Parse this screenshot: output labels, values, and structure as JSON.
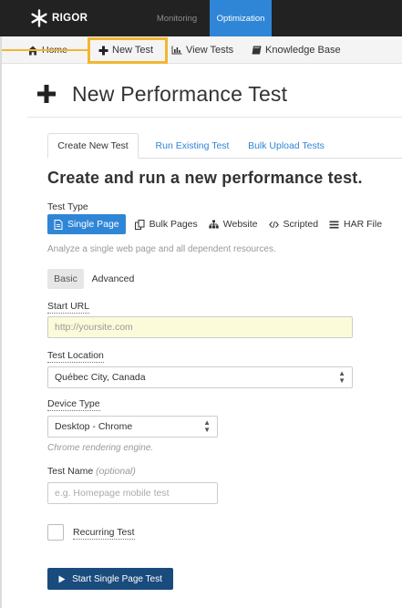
{
  "topbar": {
    "logo_text": "RIGOR",
    "tabs": [
      {
        "label": "Monitoring"
      },
      {
        "label": "Optimization"
      }
    ]
  },
  "subnav": {
    "items": [
      {
        "label": "Home",
        "icon": "home-icon"
      },
      {
        "label": "New Test",
        "icon": "plus-icon"
      },
      {
        "label": "View Tests",
        "icon": "bar-chart-icon"
      },
      {
        "label": "Knowledge Base",
        "icon": "book-icon"
      }
    ]
  },
  "page": {
    "title": "New Performance Test"
  },
  "tabs": [
    {
      "label": "Create New Test"
    },
    {
      "label": "Run Existing Test"
    },
    {
      "label": "Bulk Upload Tests"
    }
  ],
  "form": {
    "heading": "Create and run a new performance test.",
    "test_type_label": "Test Type",
    "test_types": [
      {
        "label": "Single Page",
        "icon": "document-icon"
      },
      {
        "label": "Bulk Pages",
        "icon": "copy-icon"
      },
      {
        "label": "Website",
        "icon": "sitemap-icon"
      },
      {
        "label": "Scripted",
        "icon": "code-icon"
      },
      {
        "label": "HAR File",
        "icon": "list-icon"
      }
    ],
    "test_type_help": "Analyze a single web page and all dependent resources.",
    "modes": {
      "basic": "Basic",
      "advanced": "Advanced"
    },
    "start_url_label": "Start URL",
    "start_url_placeholder": "http://yoursite.com",
    "location_label": "Test Location",
    "location_value": "Québec City, Canada",
    "device_label": "Device Type",
    "device_value": "Desktop - Chrome",
    "device_help": "Chrome rendering engine.",
    "name_label": "Test Name",
    "name_optional": "(optional)",
    "name_placeholder": "e.g. Homepage mobile test",
    "recurring_label": "Recurring Test",
    "submit_label": "Start Single Page Test"
  },
  "colors": {
    "accent": "#2f86d6",
    "topbar": "#222222",
    "highlight": "#f2b630",
    "submit": "#1a4b7d"
  }
}
